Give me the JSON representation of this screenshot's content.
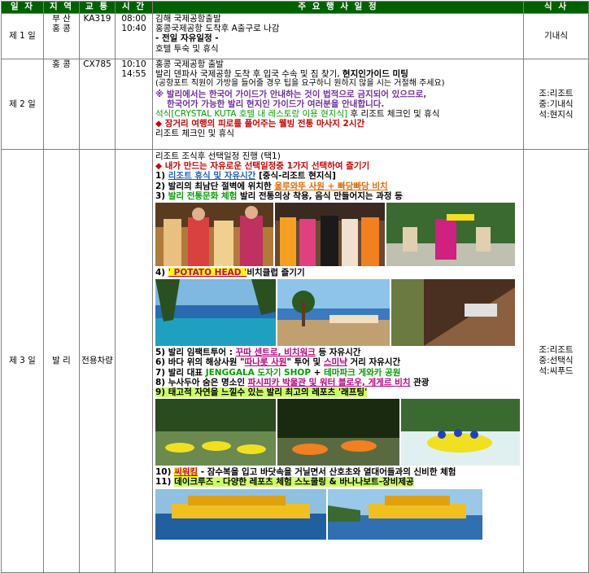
{
  "headers": {
    "day": "일 자",
    "region": "지 역",
    "transport": "교 통",
    "time": "시 간",
    "schedule": "주 요 행 사 일 정",
    "meal": "식 사"
  },
  "day1": {
    "day": "제 1 일",
    "regions": [
      "부  산",
      "홍  콩"
    ],
    "transport": "KA319",
    "times": [
      "08:00",
      "10:40"
    ],
    "lines": [
      "김해 국제공항출발",
      "홍콩국제공항 도착후 A출구로 나감",
      "- 전일 자유일정 -",
      "호텔 투숙 및 휴식"
    ],
    "meal": "기내식"
  },
  "day2": {
    "day": "제 2 일",
    "region": "홍  콩",
    "transport": "CX785",
    "times": [
      "10:10",
      "14:55"
    ],
    "line1": "홍콩 국제공항 출발",
    "line2a": "발리 덴파사 국제공항 도착 후 입국 수속 및 짐 찾기, ",
    "line2b": "현지인가이드 미팅",
    "line3": "(공항포트 직원이 가방을 들어줄 경우 팁을 요구하니 원하지 않을 시는 거절해 주세요)",
    "line4": "※ 발리에서는 한국어 가이드가 안내하는 것이 법적으로 금지되어 있으므로,",
    "line5": "한국어가 가능한 발리 현지인 가이드가 여러분을 안내합니다.",
    "line6a": "석식[CRYSTAL KUTA 호텔 내 레스토랑 이용 현지식]",
    "line6b": " 후 리조트  체크인 및 휴식",
    "line7": "◆ 장거리 여행의 피로를 풀어주는 웰빙 전통 마사지 2시간",
    "line8": "리조트 체크인 및 휴식",
    "meals": [
      "조:리조트",
      "중:기내식",
      "석:현지식"
    ]
  },
  "day3": {
    "day": "제 3 일",
    "region": "발  리",
    "transport": "전용차량",
    "intro": "리조트 조식후 선택일정 진행 (택1)",
    "choose": "◆ 내가 만드는 자유로운 선택일정중 1가지 선택하여 즐기기",
    "item1a": "1) ",
    "item1b": "리조트 휴식 및 자유시간",
    "item1c": " [중식-리조트 현지식]",
    "item2a": "2) 발리의 최남단 절벽에 위치한 ",
    "item2b": "울루와뚜 사원 + 빠당빠당 비치",
    "item3a": "3) ",
    "item3b": "발리 전통문화 체험",
    "item3c": " 발리 전통의상 착용, 음식 만들어지는 과정 등",
    "item4a": "4) ",
    "item4b": "' POTATO HEAD '",
    "item4c": "비치클럽 즐기기",
    "item5a": "5) 발리 임팩트투어 : ",
    "item5b": "꾸따 센트로, 비치워크",
    "item5c": " 등 자유시간",
    "item6a": "6) 바다 위의 해상사원 \"",
    "item6b": "따나롯 사원",
    "item6c": "\" 투어 및 ",
    "item6d": "스미냑",
    "item6e": " 거리 자유시간",
    "item7a": "7) 발리 대표 ",
    "item7b": "JENGGALA 도자기 SHOP",
    "item7c": " +  ",
    "item7d": "테마파크 게와카 공원",
    "item8a": "8) 누사두아 숨은 명소인 ",
    "item8b": "파시피카 박물관 및 워터 블로우, 게게르 비치",
    "item8c": " 관광",
    "item9": "9) 태고적 자연을 느낄수 있는 발리 최고의 레포츠 '래프팅'",
    "item10a": "10) ",
    "item10b": "씨워킹",
    "item10c": " - 잠수복을 입고 바닷속을 거닐면서 산호초와 열대어들과의 신비한 체험",
    "item11a": "11) ",
    "item11b": "데이크루즈 - 다양한 레포츠 체험 스노쿨링 & 바나나보트-장비제공",
    "meals": [
      "조:리조트",
      "중:선택식",
      "석:씨푸드"
    ]
  }
}
